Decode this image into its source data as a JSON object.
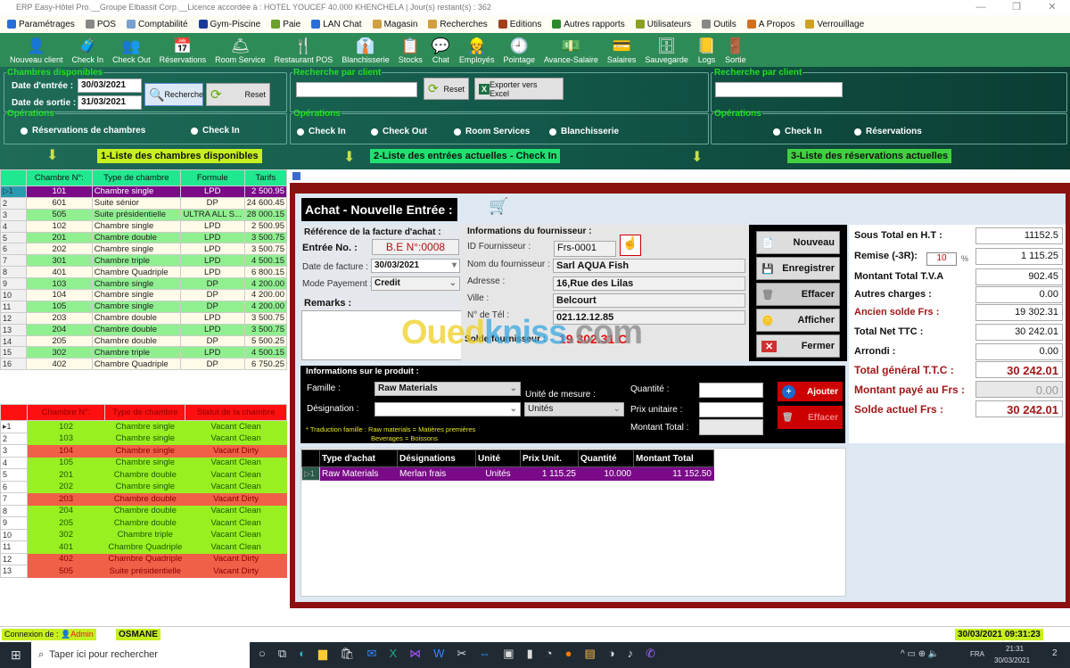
{
  "window": {
    "title": "ERP Easy-Hôtel Pro.__Groupe Elbassit Corp.__Licence accordée à : HOTEL YOUCEF 40.000 KHENCHELA | Jour(s) restant(s) : 362",
    "minimize": "—",
    "maximize": "❐",
    "close": "✕"
  },
  "menu": [
    {
      "label": "Paramétrages",
      "color": "#2a6ed8"
    },
    {
      "label": "POS",
      "color": "#888"
    },
    {
      "label": "Comptabilité",
      "color": "#7aa0d0"
    },
    {
      "label": "Gym-Piscine",
      "color": "#1a3a9a"
    },
    {
      "label": "Paie",
      "color": "#6aa02a"
    },
    {
      "label": "LAN Chat",
      "color": "#2a6ed8"
    },
    {
      "label": "Magasin",
      "color": "#d0a040"
    },
    {
      "label": "Recherches",
      "color": "#d0a040"
    },
    {
      "label": "Editions",
      "color": "#a04020"
    },
    {
      "label": "Autres rapports",
      "color": "#2a8a2a"
    },
    {
      "label": "Utilisateurs",
      "color": "#8aa020"
    },
    {
      "label": "Outils",
      "color": "#888"
    },
    {
      "label": "A Propos",
      "color": "#d07020"
    },
    {
      "label": "Verrouillage",
      "color": "#d0a020"
    }
  ],
  "toolbar": [
    {
      "label": "Nouveau client",
      "icon": "👤"
    },
    {
      "label": "Check In",
      "icon": "🧳"
    },
    {
      "label": "Check Out",
      "icon": "👥"
    },
    {
      "label": "Réservations",
      "icon": "📅"
    },
    {
      "label": "Room Service",
      "icon": "🛎"
    },
    {
      "label": "Restaurant POS",
      "icon": "🍴"
    },
    {
      "label": "Blanchisserie",
      "icon": "👔"
    },
    {
      "label": "Stocks",
      "icon": "📋"
    },
    {
      "label": "Chat",
      "icon": "💬"
    },
    {
      "label": "Employés",
      "icon": "👷"
    },
    {
      "label": "Pointage",
      "icon": "🕘"
    },
    {
      "label": "Avance-Salaire",
      "icon": "💵"
    },
    {
      "label": "Salaires",
      "icon": "💳"
    },
    {
      "label": "Sauvegarde",
      "icon": "🗄"
    },
    {
      "label": "Logs",
      "icon": "📒"
    },
    {
      "label": "Sortie",
      "icon": "🚪"
    }
  ],
  "panel1": {
    "legend": "Chambres disponibles",
    "date_in_label": "Date d'entrée :",
    "date_in": "30/03/2021",
    "date_out_label": "Date de sortie :",
    "date_out": "31/03/2021",
    "search": "Recherche",
    "reset": "Reset",
    "ops_legend": "Opérations",
    "radios": [
      "Réservations de chambres",
      "Check In"
    ],
    "banner": "1-Liste des chambres disponibles"
  },
  "panel2": {
    "legend": "Recherche par client",
    "search_value": "",
    "reset": "Reset",
    "export": "Exporter vers Excel",
    "ops_legend": "Opérations",
    "radios": [
      "Check In",
      "Check Out",
      "Room Services",
      "Blanchisserie"
    ],
    "banner": "2-Liste des entrées actuelles - Check In"
  },
  "panel3": {
    "legend": "Recherche par client",
    "search_value": "",
    "ops_legend": "Opérations",
    "radios": [
      "Check In",
      "Réservations"
    ],
    "banner": "3-Liste des réservations actuelles"
  },
  "rooms": {
    "headers": [
      "Chambre N°:",
      "Type de chambre",
      "Formule",
      "Tarifs"
    ],
    "rows": [
      [
        "101",
        "Chambre single",
        "LPD",
        "2 500.95"
      ],
      [
        "601",
        "Suite sénior",
        "DP",
        "24 600.45"
      ],
      [
        "505",
        "Suite présidentielle",
        "ULTRA ALL S...",
        "28 000.15"
      ],
      [
        "102",
        "Chambre single",
        "LPD",
        "2 500.95"
      ],
      [
        "201",
        "Chambre double",
        "LPD",
        "3 500.75"
      ],
      [
        "202",
        "Chambre single",
        "LPD",
        "3 500.75"
      ],
      [
        "301",
        "Chambre triple",
        "LPD",
        "4 500.15"
      ],
      [
        "401",
        "Chambre Quadriple",
        "LPD",
        "6 800.15"
      ],
      [
        "103",
        "Chambre single",
        "DP",
        "4 200.00"
      ],
      [
        "104",
        "Chambre single",
        "DP",
        "4 200.00"
      ],
      [
        "105",
        "Chambre single",
        "DP",
        "4 200.00"
      ],
      [
        "203",
        "Chambre double",
        "LPD",
        "3 500.75"
      ],
      [
        "204",
        "Chambre double",
        "LPD",
        "3 500.75"
      ],
      [
        "205",
        "Chambre double",
        "DP",
        "5 500.25"
      ],
      [
        "302",
        "Chambre triple",
        "LPD",
        "4 500.15"
      ],
      [
        "402",
        "Chambre Quadriple",
        "DP",
        "6 750.25"
      ]
    ]
  },
  "status_rooms": {
    "headers": [
      "Chambre N°:",
      "Type de chambre",
      "Statut de la chambre"
    ],
    "rows": [
      [
        "102",
        "Chambre single",
        "Vacant Clean"
      ],
      [
        "103",
        "Chambre single",
        "Vacant Clean"
      ],
      [
        "104",
        "Chambre single",
        "Vacant Dirty"
      ],
      [
        "105",
        "Chambre single",
        "Vacant Clean"
      ],
      [
        "201",
        "Chambre double",
        "Vacant Clean"
      ],
      [
        "202",
        "Chambre single",
        "Vacant Clean"
      ],
      [
        "203",
        "Chambre double",
        "Vacant Dirty"
      ],
      [
        "204",
        "Chambre double",
        "Vacant Clean"
      ],
      [
        "205",
        "Chambre double",
        "Vacant Clean"
      ],
      [
        "302",
        "Chambre triple",
        "Vacant Clean"
      ],
      [
        "401",
        "Chambre Quadriple",
        "Vacant Clean"
      ],
      [
        "402",
        "Chambre Quadriple",
        "Vacant Dirty"
      ],
      [
        "505",
        "Suite présidentielle",
        "Vacant Dirty"
      ]
    ]
  },
  "achat": {
    "title": "Achat - Nouvelle Entrée :",
    "ref_title": "Référence de la facture d'achat :",
    "entree_label": "Entrée No. :",
    "entree": "B.E N°:0008",
    "date_label": "Date de facture :",
    "date": "30/03/2021",
    "mode_label": "Mode Payement :",
    "mode": "Credit",
    "remarks_label": "Remarks :",
    "remarks": "",
    "fourn_title": "Informations du fournisseur :",
    "id_label": "ID Fournisseur :",
    "id": "Frs-0001",
    "nom_label": "Nom du fournisseur :",
    "nom": "Sarl AQUA Fish",
    "adresse_label": "Adresse :",
    "adresse": "16,Rue des Lilas",
    "ville_label": "Ville :",
    "ville": "Belcourt",
    "tel_label": "N° de Tél :",
    "tel": "021.12.12.85",
    "solde_label": "Solde fournisseur :",
    "solde": "19 302.31 C",
    "buttons": [
      "Nouveau",
      "Enregistrer",
      "Effacer",
      "Afficher",
      "Fermer"
    ],
    "totals": [
      {
        "label": "Sous Total  en H.T :",
        "value": "11152.5",
        "style": "n"
      },
      {
        "label": "Remise (-3R):",
        "value": "1 115.25",
        "style": "n"
      },
      {
        "label": "Montant Total T.V.A",
        "value": "902.45",
        "style": "n"
      },
      {
        "label": "Autres charges :",
        "value": "0.00",
        "style": "n"
      },
      {
        "label": "Ancien solde  Frs :",
        "value": "19 302.31",
        "style": "r"
      },
      {
        "label": "Total Net TTC :",
        "value": "30 242.01",
        "style": "n"
      },
      {
        "label": "Arrondi :",
        "value": "0.00",
        "style": "n"
      },
      {
        "label": "Total général T.T.C :",
        "value": "30 242.01",
        "style": "R"
      },
      {
        "label": "Montant payé  au Frs :",
        "value": "0.00",
        "style": "G"
      },
      {
        "label": "Solde actuel  Frs  :",
        "value": "30 242.01",
        "style": "R"
      }
    ],
    "remise_pct": "10",
    "pct": "%",
    "prod_title": "Informations sur le produit :",
    "famille_label": "Famille :",
    "famille": "Raw Materials",
    "designation_label": "Désignation :",
    "designation": "",
    "unite_label": "Unité de mesure :",
    "unite": "Unités",
    "qte_label": "Quantité :",
    "qte": "",
    "prix_label": "Prix unitaire :",
    "prix": "",
    "montant_label": "Montant Total :",
    "montant": "",
    "ajouter": "Ajouter",
    "effacer": "Effacer",
    "note1": "* Traduction famille : Raw materials = Matières premières",
    "note2": "Beverages = Boissons",
    "grid_headers": [
      "Type d'achat",
      "Désignations",
      "Unité",
      "Prix Unit.",
      "Quantité",
      "Montant Total"
    ],
    "grid_rows": [
      [
        "Raw Materials",
        "Merlan frais",
        "Unités",
        "1 115.25",
        "10.000",
        "11 152.50"
      ]
    ]
  },
  "watermark": "Ouedkniss.com",
  "statusbar": {
    "conn_label": "Connexion de :",
    "role": "Admin",
    "user": "OSMANE",
    "datetime": "30/03/2021 09:31:23"
  },
  "taskbar": {
    "search": "Taper ici pour rechercher",
    "lang": "FRA",
    "time": "21:31",
    "date": "30/03/2021",
    "notif": "2"
  }
}
